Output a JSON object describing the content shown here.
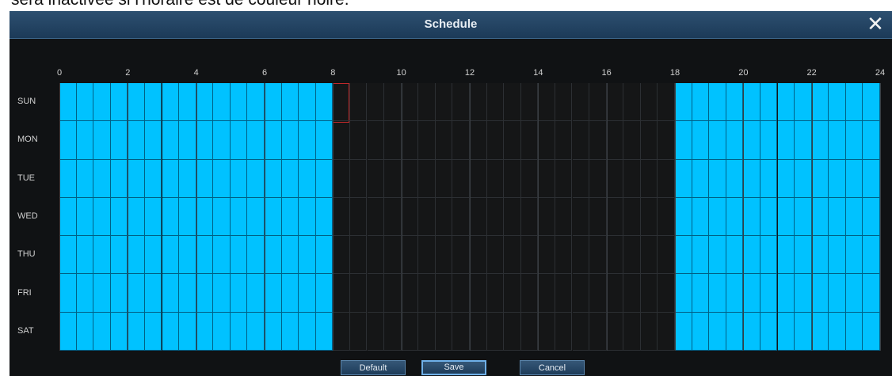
{
  "caption": "sera inactivée si l'horaire est de couleur noire.",
  "dialog": {
    "title": "Schedule",
    "close_label": "✕"
  },
  "hours": [
    "0",
    "2",
    "4",
    "6",
    "8",
    "10",
    "12",
    "14",
    "16",
    "18",
    "20",
    "22",
    "24"
  ],
  "days": [
    "SUN",
    "MON",
    "TUE",
    "WED",
    "THU",
    "FRI",
    "SAT"
  ],
  "schedule": {
    "slots_per_day": 48,
    "active_ranges_hours": [
      [
        0,
        8
      ],
      [
        18,
        24
      ]
    ],
    "active_color": "#00c2ff",
    "inactive_color": "#151617"
  },
  "buttons": {
    "default_label": "Default",
    "save_label": "Save",
    "cancel_label": "Cancel"
  }
}
